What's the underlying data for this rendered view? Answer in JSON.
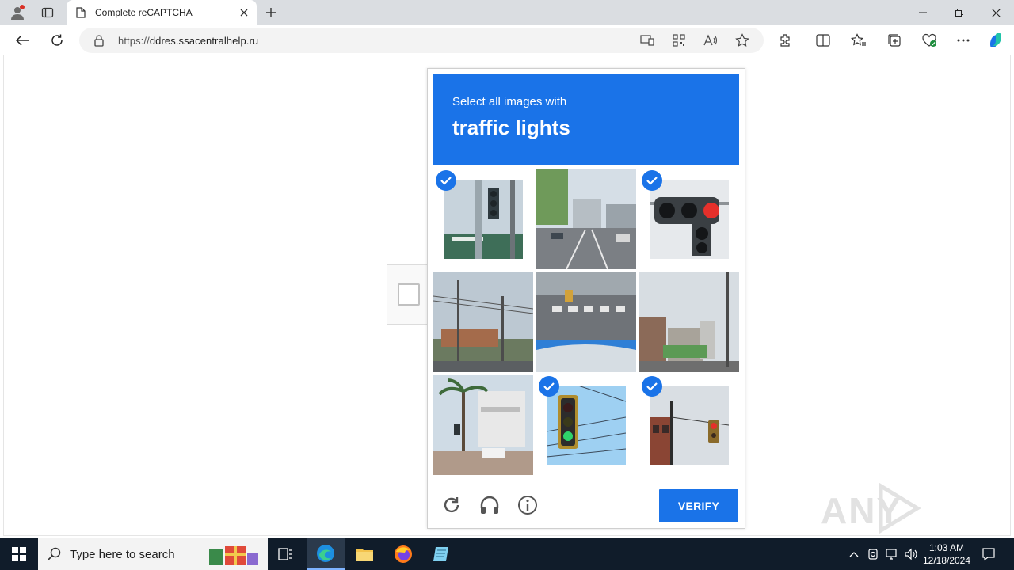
{
  "browser": {
    "tab_title": "Complete reCAPTCHA",
    "url_scheme": "https://",
    "url_host": "ddres.ssacentralhelp.ru"
  },
  "captcha": {
    "prompt": "Select all images with",
    "target": "traffic lights",
    "tiles": [
      {
        "row": 1,
        "col": 1,
        "scene": "traffic-light-on-pole",
        "selected": true
      },
      {
        "row": 1,
        "col": 2,
        "scene": "city-street",
        "selected": false
      },
      {
        "row": 1,
        "col": 3,
        "scene": "traffic-light-red-closeup",
        "selected": true
      },
      {
        "row": 2,
        "col": 1,
        "scene": "roadside-utility-pole",
        "selected": false
      },
      {
        "row": 2,
        "col": 2,
        "scene": "crosswalk-intersection",
        "selected": false
      },
      {
        "row": 2,
        "col": 3,
        "scene": "street-with-buildings",
        "selected": false
      },
      {
        "row": 3,
        "col": 1,
        "scene": "palm-tree-street",
        "selected": false
      },
      {
        "row": 3,
        "col": 2,
        "scene": "traffic-light-green-wires",
        "selected": true
      },
      {
        "row": 3,
        "col": 3,
        "scene": "traffic-light-brick-building",
        "selected": true
      }
    ],
    "verify_label": "VERIFY",
    "footer_icons": [
      "reload-icon",
      "headphones-icon",
      "info-icon"
    ]
  },
  "watermark": "ANY RUN",
  "taskbar": {
    "search_placeholder": "Type here to search",
    "time": "1:03 AM",
    "date": "12/18/2024"
  },
  "colors": {
    "accent": "#1a73e8",
    "tabbar": "#dadde1",
    "taskbar": "#101c2a"
  }
}
